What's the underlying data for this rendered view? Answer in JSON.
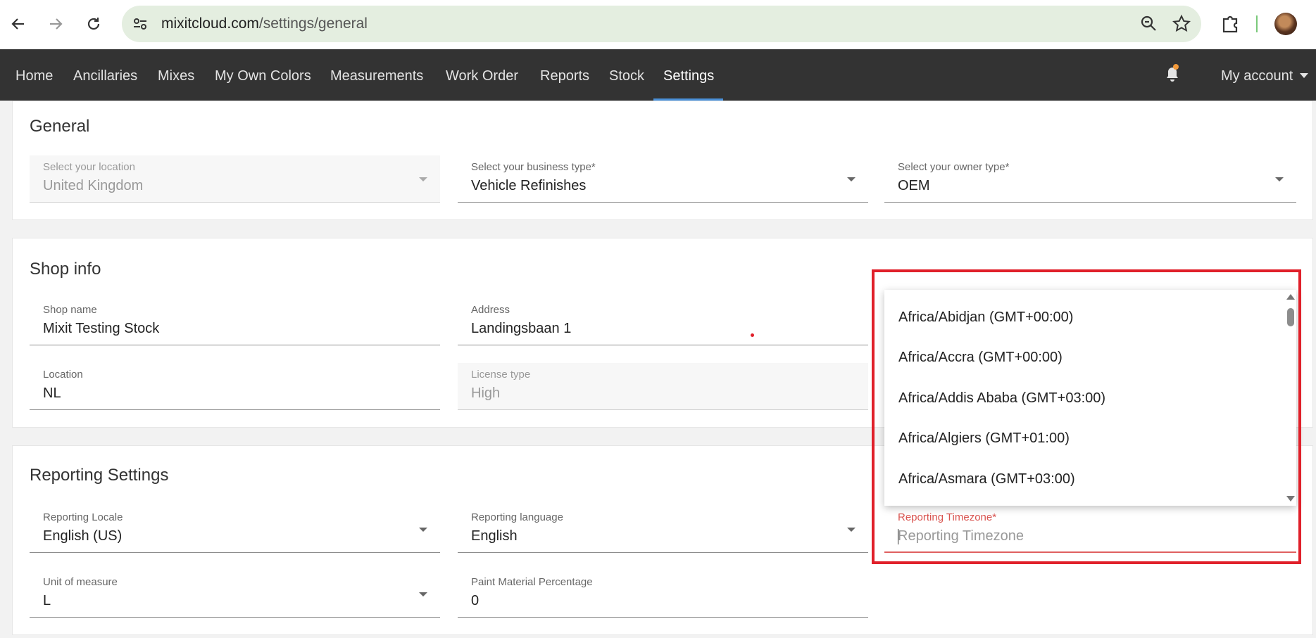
{
  "browser": {
    "url_host": "mixitcloud.com",
    "url_path": "/settings/general",
    "icons": [
      "back-arrow-icon",
      "forward-arrow-icon",
      "reload-icon",
      "site-settings-icon",
      "zoom-icon",
      "bookmark-star-icon",
      "extensions-icon",
      "profile-avatar"
    ]
  },
  "nav": {
    "items": [
      "Home",
      "Ancillaries",
      "Mixes",
      "My Own Colors",
      "Measurements",
      "Work Order",
      "Reports",
      "Stock",
      "Settings"
    ],
    "active": "Settings",
    "account_label": "My account"
  },
  "general": {
    "title": "General",
    "location": {
      "label": "Select your location",
      "value": "United Kingdom"
    },
    "business_type": {
      "label": "Select your business type*",
      "value": "Vehicle Refinishes"
    },
    "owner_type": {
      "label": "Select your owner type*",
      "value": "OEM"
    }
  },
  "shop_info": {
    "title": "Shop info",
    "shop_name": {
      "label": "Shop name",
      "value": "Mixit Testing Stock"
    },
    "address": {
      "label": "Address",
      "value": "Landingsbaan 1"
    },
    "location": {
      "label": "Location",
      "value": "NL"
    },
    "license_type": {
      "label": "License type",
      "value": "High"
    }
  },
  "reporting": {
    "title": "Reporting Settings",
    "locale": {
      "label": "Reporting Locale",
      "value": "English (US)"
    },
    "language": {
      "label": "Reporting language",
      "value": "English"
    },
    "timezone": {
      "label": "Reporting Timezone*",
      "placeholder": "Reporting Timezone"
    },
    "unit": {
      "label": "Unit of measure",
      "value": "L"
    },
    "paint_pct": {
      "label": "Paint Material Percentage",
      "value": "0"
    }
  },
  "timezone_dropdown": {
    "options": [
      "Africa/Abidjan (GMT+00:00)",
      "Africa/Accra (GMT+00:00)",
      "Africa/Addis Ababa (GMT+03:00)",
      "Africa/Algiers (GMT+01:00)",
      "Africa/Asmara (GMT+03:00)"
    ]
  },
  "colors": {
    "nav_bg": "#333333",
    "active_underline": "#4a90d9",
    "focus_red": "#d9534f",
    "highlight_red": "#e0202a"
  }
}
